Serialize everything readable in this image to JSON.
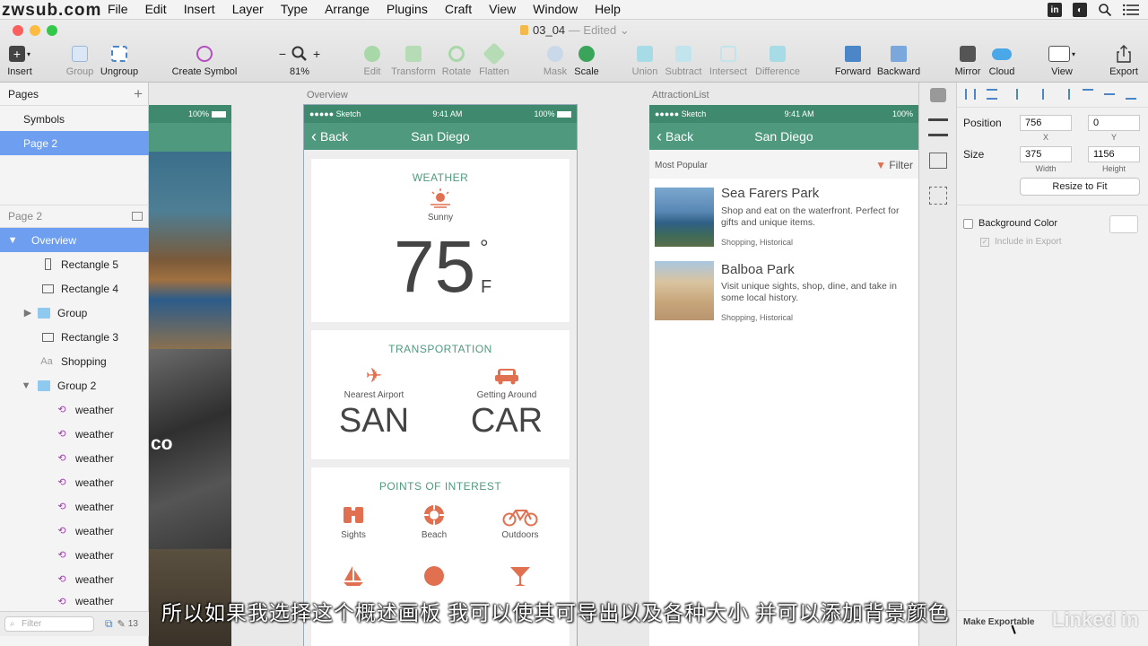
{
  "watermark": "zwsub.com",
  "menubar": {
    "items": [
      "File",
      "Edit",
      "Insert",
      "Layer",
      "Type",
      "Arrange",
      "Plugins",
      "Craft",
      "View",
      "Window",
      "Help"
    ]
  },
  "window": {
    "title": "03_04",
    "edited": "— Edited"
  },
  "toolbar": {
    "insert": "Insert",
    "group": "Group",
    "ungroup": "Ungroup",
    "create_symbol": "Create Symbol",
    "zoom": "81%",
    "edit": "Edit",
    "transform": "Transform",
    "rotate": "Rotate",
    "flatten": "Flatten",
    "mask": "Mask",
    "scale": "Scale",
    "union": "Union",
    "subtract": "Subtract",
    "intersect": "Intersect",
    "difference": "Difference",
    "forward": "Forward",
    "backward": "Backward",
    "mirror": "Mirror",
    "cloud": "Cloud",
    "view": "View",
    "export": "Export",
    "zoom_minus": "−",
    "zoom_plus": "+"
  },
  "left_panel": {
    "pages_header": "Pages",
    "add": "+",
    "pages": [
      "Symbols",
      "Page 2"
    ],
    "layers_header": "Page 2",
    "layers": [
      {
        "name": "Overview",
        "type": "artboard"
      },
      {
        "name": "Rectangle 5",
        "type": "rect"
      },
      {
        "name": "Rectangle 4",
        "type": "rect"
      },
      {
        "name": "Group",
        "type": "group"
      },
      {
        "name": "Rectangle 3",
        "type": "rect"
      },
      {
        "name": "Shopping",
        "type": "text"
      },
      {
        "name": "Group 2",
        "type": "group"
      },
      {
        "name": "weather",
        "type": "symbol"
      },
      {
        "name": "weather",
        "type": "symbol"
      },
      {
        "name": "weather",
        "type": "symbol"
      },
      {
        "name": "weather",
        "type": "symbol"
      },
      {
        "name": "weather",
        "type": "symbol"
      },
      {
        "name": "weather",
        "type": "symbol"
      },
      {
        "name": "weather",
        "type": "symbol"
      },
      {
        "name": "weather",
        "type": "symbol"
      },
      {
        "name": "weather",
        "type": "symbol"
      }
    ],
    "filter_placeholder": "Filter",
    "count": "13",
    "text_icon": "Aa"
  },
  "canvas": {
    "left_fragment": {
      "battery": "100%",
      "text": "co"
    },
    "overview": {
      "label": "Overview",
      "status": {
        "carrier": "●●●●● Sketch",
        "time": "9:41 AM",
        "battery": "100%"
      },
      "nav": {
        "back": "Back",
        "title": "San Diego"
      },
      "weather": {
        "heading": "WEATHER",
        "condition": "Sunny",
        "temp": "75",
        "degree": "°",
        "unit": "F"
      },
      "transportation": {
        "heading": "TRANSPORTATION",
        "left_label": "Nearest Airport",
        "left_value": "SAN",
        "right_label": "Getting Around",
        "right_value": "CAR"
      },
      "poi": {
        "heading": "POINTS OF INTEREST",
        "items": [
          "Sights",
          "Beach",
          "Outdoors"
        ]
      }
    },
    "attraction": {
      "label": "AttractionList",
      "status": {
        "carrier": "●●●●● Sketch",
        "time": "9:41 AM",
        "battery": "100%"
      },
      "nav": {
        "back": "Back",
        "title": "San Diego"
      },
      "subheader": {
        "left": "Most Popular",
        "right": "Filter"
      },
      "items": [
        {
          "title": "Sea Farers Park",
          "desc": "Shop and eat on the waterfront. Perfect for gifts and unique items.",
          "tags": "Shopping, Historical"
        },
        {
          "title": "Balboa Park",
          "desc": "Visit unique sights, shop, dine, and take in some local history.",
          "tags": "Shopping, Historical"
        }
      ]
    }
  },
  "inspector": {
    "position_label": "Position",
    "x": "756",
    "y": "0",
    "x_label": "X",
    "y_label": "Y",
    "size_label": "Size",
    "width": "375",
    "height": "1156",
    "w_label": "Width",
    "h_label": "Height",
    "resize_button": "Resize to Fit",
    "bg_color_label": "Background Color",
    "include_export": "Include in Export",
    "make_exportable": "Make Exportable",
    "brand": "Linked in"
  },
  "subtitle": "所以如果我选择这个概述画板 我可以使其可导出以及各种大小 并可以添加背景颜色",
  "colors": {
    "accent_green": "#4f9a7e",
    "selection_blue": "#6e9ef0",
    "icon_orange": "#e07050"
  }
}
